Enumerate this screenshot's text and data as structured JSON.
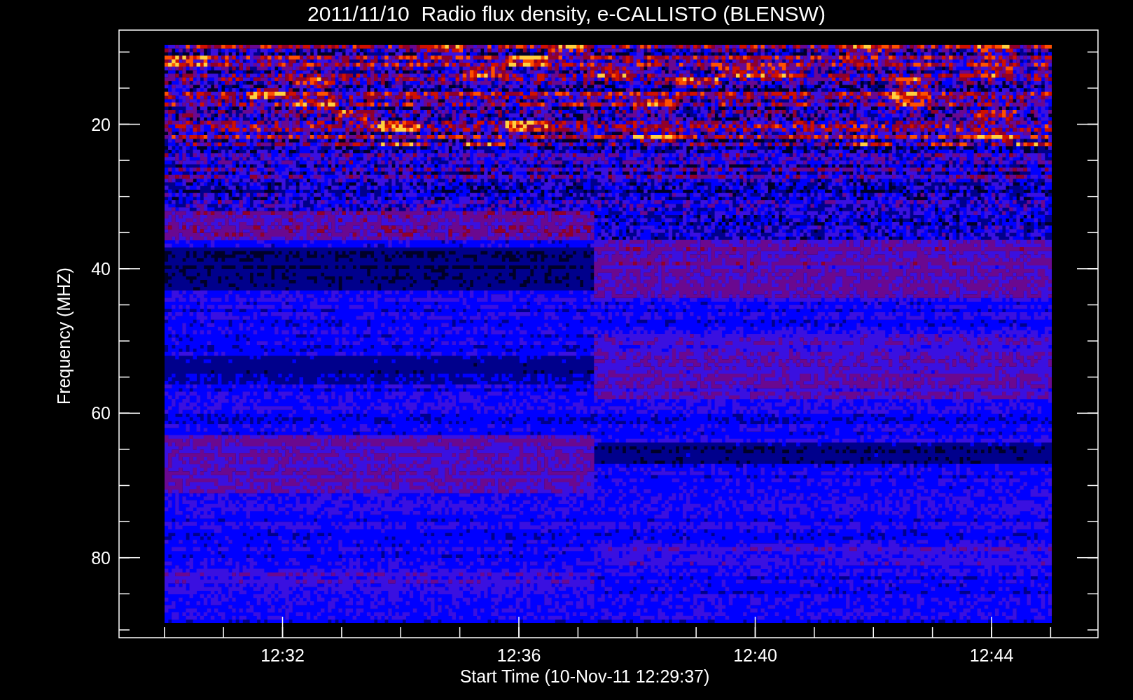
{
  "title": "2011/11/10  Radio flux density, e-CALLISTO (BLENSW)",
  "plot": {
    "ylabel": "Frequency (MHZ)",
    "xlabel": "Start Time (10-Nov-11 12:29:37)",
    "yticks": [
      "20",
      "40",
      "60",
      "80"
    ],
    "xticks": [
      "12:32",
      "12:36",
      "12:40",
      "12:44"
    ]
  }
}
